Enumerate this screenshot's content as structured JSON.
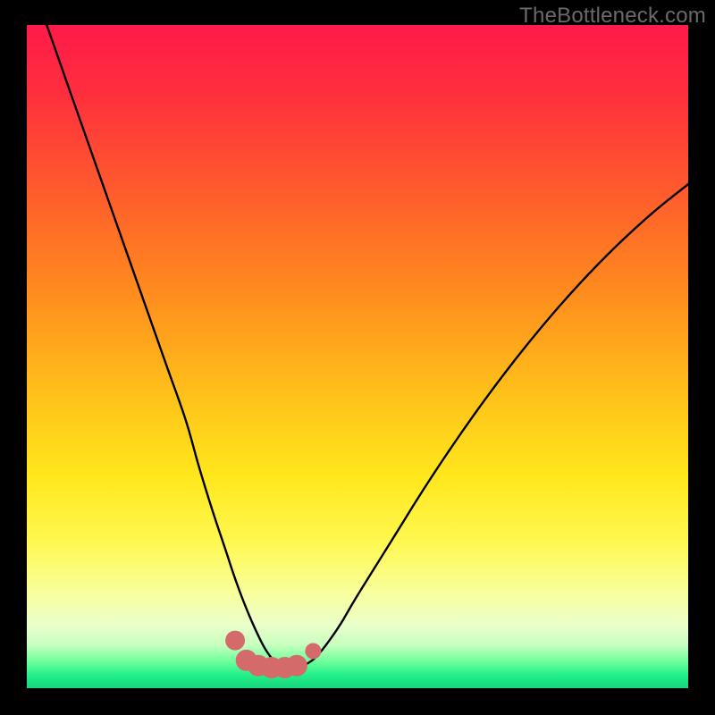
{
  "watermark": "TheBottleneck.com",
  "colors": {
    "background": "#000000",
    "gradient_stops": [
      {
        "offset": 0.0,
        "color": "#ff1a4a"
      },
      {
        "offset": 0.1,
        "color": "#ff2e3e"
      },
      {
        "offset": 0.25,
        "color": "#ff5b2d"
      },
      {
        "offset": 0.4,
        "color": "#ff8b1e"
      },
      {
        "offset": 0.55,
        "color": "#ffbf1a"
      },
      {
        "offset": 0.68,
        "color": "#ffe71c"
      },
      {
        "offset": 0.78,
        "color": "#fff850"
      },
      {
        "offset": 0.86,
        "color": "#f7ffa0"
      },
      {
        "offset": 0.905,
        "color": "#eaffcb"
      },
      {
        "offset": 0.935,
        "color": "#c7ffbf"
      },
      {
        "offset": 0.96,
        "color": "#6cff9a"
      },
      {
        "offset": 0.98,
        "color": "#23f08a"
      },
      {
        "offset": 1.0,
        "color": "#15d67c"
      }
    ],
    "curve": "#000000",
    "marker": "#d46a6a"
  },
  "chart_data": {
    "type": "line",
    "title": "",
    "xlabel": "",
    "ylabel": "",
    "xlim": [
      0,
      100
    ],
    "ylim": [
      0,
      100
    ],
    "grid": false,
    "curve": {
      "name": "bottleneck-curve",
      "x": [
        0,
        3,
        6,
        9,
        12,
        15,
        18,
        21,
        24,
        26,
        28,
        30,
        31.5,
        33,
        34.5,
        36,
        37.5,
        39,
        40.5,
        42,
        44,
        47,
        50,
        55,
        60,
        65,
        70,
        75,
        80,
        85,
        90,
        95,
        100
      ],
      "y": [
        108,
        100,
        91.5,
        83,
        74.5,
        66,
        57.5,
        49,
        40.5,
        33.5,
        27,
        21,
        16.5,
        12.5,
        9,
        6,
        4,
        3.1,
        3.1,
        3.5,
        5,
        9,
        14,
        22,
        30,
        37.5,
        44.5,
        51,
        57,
        62.5,
        67.5,
        72,
        76
      ]
    },
    "markers": {
      "name": "bottleneck-markers",
      "x": [
        31.5,
        33.2,
        35,
        37,
        39,
        40.8,
        43.3
      ],
      "y": [
        7.2,
        4.2,
        3.4,
        3.1,
        3.1,
        3.4,
        5.6
      ],
      "size": [
        11,
        12,
        12,
        12,
        12,
        12,
        9
      ]
    }
  }
}
